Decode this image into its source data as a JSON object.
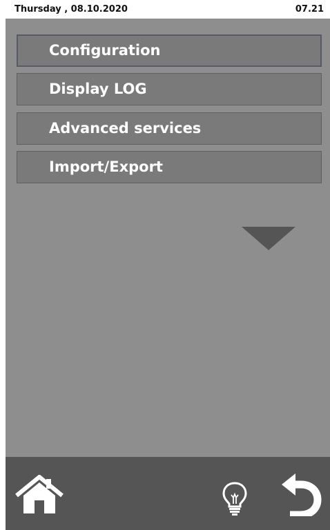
{
  "status_bar": {
    "date": "Thursday , 08.10.2020",
    "time": "07.21"
  },
  "menu": {
    "items": [
      {
        "label": "Configuration",
        "selected": true
      },
      {
        "label": "Display LOG",
        "selected": false
      },
      {
        "label": "Advanced services",
        "selected": false
      },
      {
        "label": "Import/Export",
        "selected": false
      }
    ]
  },
  "icons": {
    "scroll": "scroll-down-arrow-icon",
    "home": "home-icon",
    "hint": "lightbulb-icon",
    "back": "back-arrow-icon"
  },
  "colors": {
    "panel_bg": "#8e8e8e",
    "button_bg": "#7a7a7a",
    "bottom_bar_bg": "#555555",
    "text": "#ffffff"
  }
}
